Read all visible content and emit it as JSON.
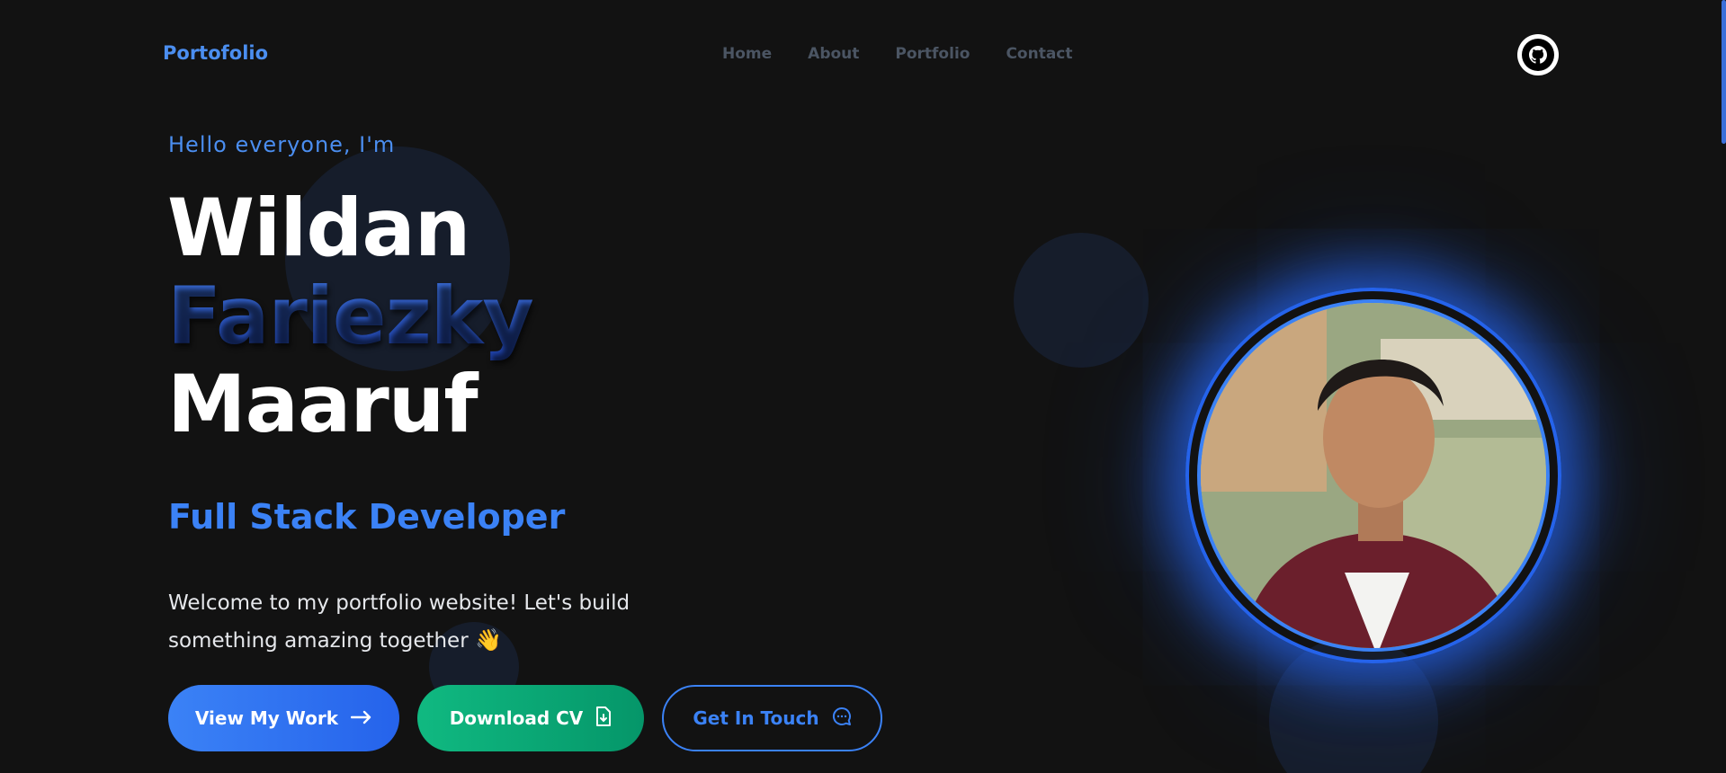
{
  "nav": {
    "brand": "Portofolio",
    "links": [
      "Home",
      "About",
      "Portfolio",
      "Contact"
    ],
    "github_icon": "github-icon"
  },
  "hero": {
    "greeting": "Hello everyone, I'm",
    "name_line1": "Wildan",
    "name_line2": "Fariezky",
    "name_line3": "Maaruf",
    "role": "Full Stack Developer",
    "description": "Welcome to my portfolio website! Let's build something amazing together",
    "wave_emoji": "👋"
  },
  "buttons": {
    "work": "View My Work",
    "cv": "Download CV",
    "touch": "Get In Touch"
  },
  "colors": {
    "accent": "#3b82f6",
    "cv_green": "#10b981",
    "background": "#121212"
  }
}
